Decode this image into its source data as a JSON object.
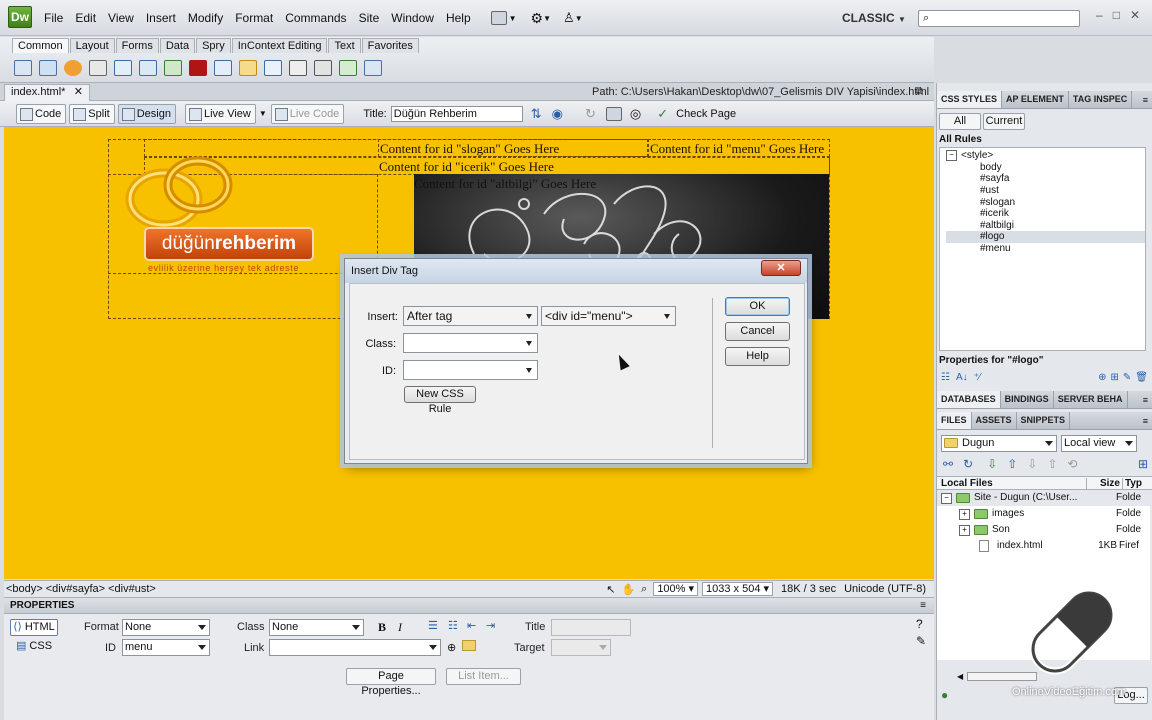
{
  "app": {
    "logo": "Dw",
    "workspace": "CLASSIC",
    "search_placeholder": "",
    "window_controls": [
      "–",
      "□",
      "✕"
    ]
  },
  "menubar": {
    "items": [
      "File",
      "Edit",
      "View",
      "Insert",
      "Modify",
      "Format",
      "Commands",
      "Site",
      "Window",
      "Help"
    ]
  },
  "insertbar": {
    "tabs": [
      "Common",
      "Layout",
      "Forms",
      "Data",
      "Spry",
      "InContext Editing",
      "Text",
      "Favorites"
    ]
  },
  "document": {
    "tab_title": "index.html*",
    "path": "Path:  C:\\Users\\Hakan\\Desktop\\dw\\07_Gelismis DIV Yapisi\\index.html"
  },
  "doctoolbar": {
    "code": "Code",
    "split": "Split",
    "design": "Design",
    "live_view": "Live View",
    "live_code": "Live Code",
    "title_label": "Title:",
    "title_value": "Düğün Rehberim",
    "check_page": "Check Page"
  },
  "canvas": {
    "slogan": "Content for id \"slogan\" Goes Here",
    "menu": "Content for id \"menu\" Goes Here",
    "icerik": "Content for id \"icerik\" Goes Here",
    "overlap": "Content for id \"altbilgi\" Goes Here",
    "logo_main": "düğün",
    "logo_bold": "rehberim",
    "logo_tagline": "evlilik üzerine herşey tek adreste"
  },
  "dialog": {
    "title": "Insert Div Tag",
    "close": "✕",
    "insert_label": "Insert:",
    "insert_value": "After tag",
    "tag_value": "<div id=\"menu\">",
    "class_label": "Class:",
    "class_value": "",
    "id_label": "ID:",
    "id_value": "",
    "new_css_rule": "New CSS Rule",
    "ok": "OK",
    "cancel": "Cancel",
    "help": "Help"
  },
  "statusbar": {
    "tag_selector": "<body> <div#sayfa> <div#ust>",
    "zoom": "100%",
    "size": "1033 x 504",
    "download": "18K / 3 sec",
    "encoding": "Unicode (UTF-8)"
  },
  "properties": {
    "title": "PROPERTIES",
    "html_btn": "HTML",
    "css_btn": "CSS",
    "format_label": "Format",
    "format_value": "None",
    "id_label": "ID",
    "id_value": "menu",
    "class_label": "Class",
    "class_value": "None",
    "link_label": "Link",
    "link_value": "",
    "bold": "B",
    "italic": "I",
    "title_label": "Title",
    "target_label": "Target",
    "page_properties": "Page Properties...",
    "list_item": "List Item..."
  },
  "css_panel": {
    "tabs": [
      "CSS STYLES",
      "AP ELEMENT",
      "TAG INSPEC"
    ],
    "all": "All",
    "current": "Current",
    "all_rules": "All Rules",
    "rules": [
      "<style>",
      "body",
      "#sayfa",
      "#ust",
      "#slogan",
      "#icerik",
      "#altbilgi",
      "#logo",
      "#menu"
    ],
    "selected_index": 7,
    "properties_for": "Properties for \"#logo\""
  },
  "db_panel": {
    "tabs": [
      "DATABASES",
      "BINDINGS",
      "SERVER BEHA"
    ]
  },
  "files_panel": {
    "tabs": [
      "FILES",
      "ASSETS",
      "SNIPPETS"
    ],
    "site": "Dugun",
    "view": "Local view",
    "header_local": "Local Files",
    "header_size": "Size",
    "header_type": "Typ",
    "items": [
      {
        "name": "Site - Dugun (C:\\User...",
        "size": "",
        "type": "Folde"
      },
      {
        "name": "images",
        "size": "",
        "type": "Folde"
      },
      {
        "name": "Son",
        "size": "",
        "type": "Folde"
      },
      {
        "name": "index.html",
        "size": "1KB",
        "type": "Firef"
      }
    ],
    "log": "Log..."
  },
  "watermark": {
    "text": "OnlineVideoEğitim.com"
  },
  "colors": {
    "canvas_bg": "#f7c100",
    "logo_orange": "#e35a0c",
    "dialog_close": "#c8432b"
  }
}
